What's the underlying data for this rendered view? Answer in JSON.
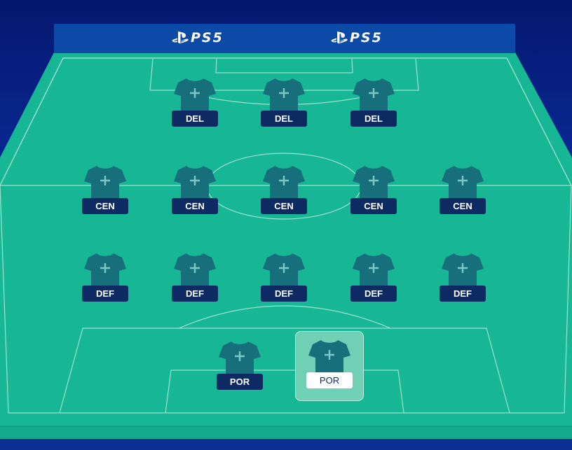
{
  "colors": {
    "background": "#0a2d9c",
    "header_bar": "#0b4aa6",
    "pitch": "#17b695",
    "pitch_lines": "#a9e8d6",
    "shirt": "#176f7c",
    "label_bg": "#0d2a63",
    "selected_slot": "#6fd0b5"
  },
  "sponsors": [
    {
      "icon": "playstation-icon",
      "text": "PS5"
    },
    {
      "icon": "playstation-icon",
      "text": "PS5"
    }
  ],
  "formation": {
    "forwards": [
      "DEL",
      "DEL",
      "DEL"
    ],
    "midfielders": [
      "CEN",
      "CEN",
      "CEN",
      "CEN",
      "CEN"
    ],
    "defenders": [
      "DEF",
      "DEF",
      "DEF",
      "DEF",
      "DEF"
    ],
    "goalkeepers": [
      "POR",
      "POR"
    ]
  },
  "slot_icon": "plus-icon",
  "selected_slot": {
    "row": "goalkeepers",
    "index": 1
  }
}
